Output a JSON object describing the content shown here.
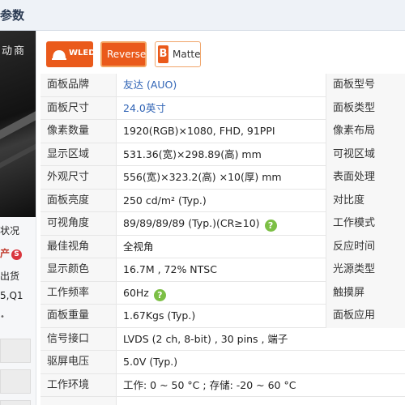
{
  "header": {
    "title": "参数"
  },
  "sidebar": {
    "banner_text": "动商",
    "lines": [
      "状况",
      "产",
      "出货",
      "5,Q1",
      "•"
    ],
    "badge_text": "S"
  },
  "badges": {
    "wled": "WLED",
    "reverse": "Reverse",
    "matte": "Matte",
    "matte_icon": "B"
  },
  "help_icon": "?",
  "spec": {
    "rows": [
      {
        "label": "面板品牌",
        "value": "友达 (AUO)",
        "right": "面板型号"
      },
      {
        "label": "面板尺寸",
        "value": "24.0英寸",
        "right": "面板类型"
      },
      {
        "label": "像素数量",
        "value": "1920(RGB)×1080, FHD, 91PPI",
        "right": "像素布局"
      },
      {
        "label": "显示区域",
        "value": "531.36(宽)×298.89(高) mm",
        "right": "可视区域"
      },
      {
        "label": "外观尺寸",
        "value": "556(宽)×323.2(高) ×10(厚) mm",
        "right": "表面处理"
      },
      {
        "label": "面板亮度",
        "value": "250 cd/m² (Typ.)",
        "right": "对比度"
      },
      {
        "label": "可视角度",
        "value": "89/89/89/89 (Typ.)(CR≥10)",
        "right": "工作模式"
      },
      {
        "label": "最佳视角",
        "value": "全视角",
        "right": "反应时间"
      },
      {
        "label": "显示颜色",
        "value": "16.7M , 72% NTSC",
        "right": "光源类型"
      },
      {
        "label": "工作频率",
        "value": "60Hz",
        "right": "触摸屏"
      },
      {
        "label": "面板重量",
        "value": "1.67Kgs (Typ.)",
        "right": "面板应用"
      },
      {
        "label": "信号接口",
        "value": "LVDS (2 ch, 8-bit) , 30 pins , 端子",
        "right": ""
      },
      {
        "label": "驱屏电压",
        "value": "5.0V (Typ.)",
        "right": ""
      },
      {
        "label": "工作环境",
        "value": "工作: 0 ~ 50 °C ; 存储: -20 ~ 60 °C",
        "right": ""
      }
    ]
  },
  "colors": {
    "accent": "#ea5a1b",
    "link": "#2f63b5",
    "help": "#7cbf45"
  }
}
